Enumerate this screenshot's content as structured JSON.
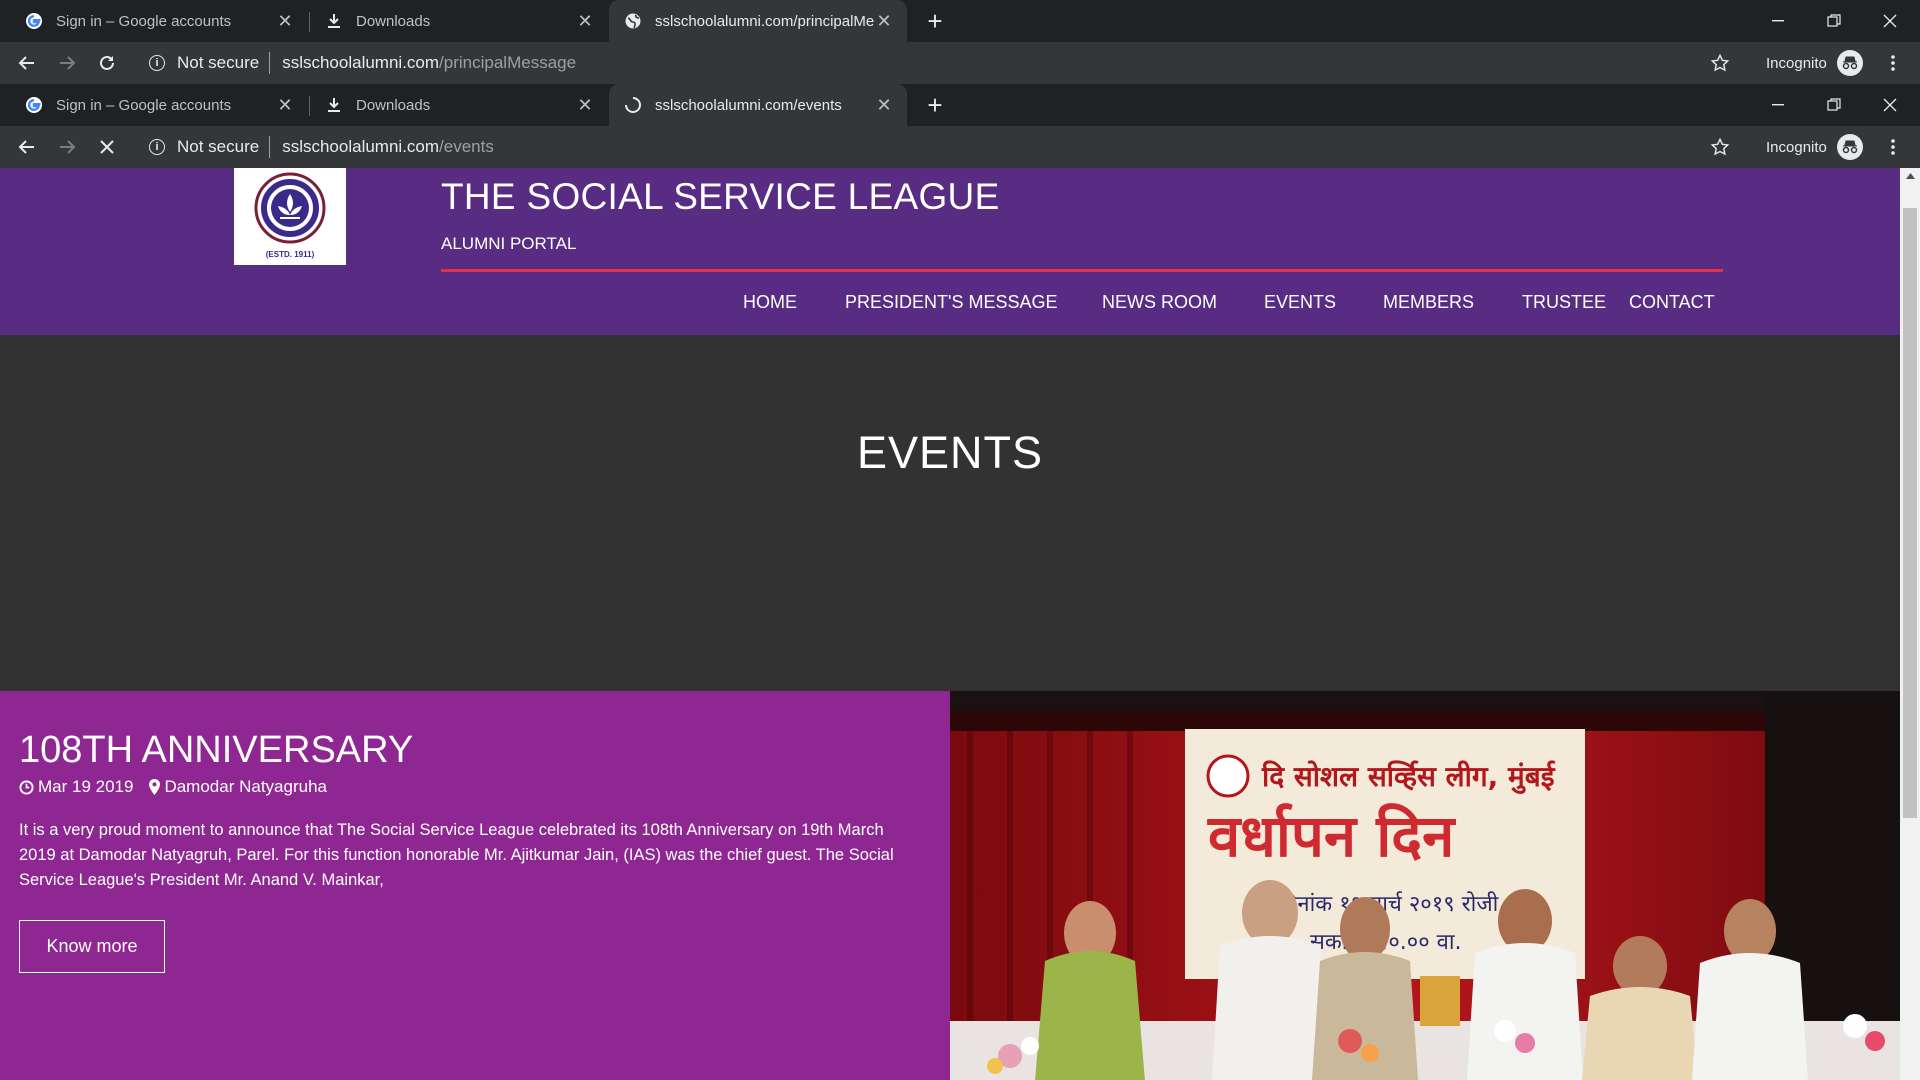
{
  "browser_back": {
    "tabs": [
      {
        "title": "Sign in – Google accounts",
        "favicon": "google-g-icon"
      },
      {
        "title": "Downloads",
        "favicon": "download-icon"
      },
      {
        "title": "sslschoolalumni.com/principalMe",
        "favicon": "globe-icon"
      }
    ],
    "security_label": "Not secure",
    "url_host": "sslschoolalumni.com",
    "url_path": "/principalMessage",
    "incognito_label": "Incognito"
  },
  "browser": {
    "tabs": [
      {
        "title": "Sign in – Google accounts",
        "favicon": "google-g-icon"
      },
      {
        "title": "Downloads",
        "favicon": "download-icon"
      },
      {
        "title": "sslschoolalumni.com/events",
        "favicon": "loading-spinner-icon"
      }
    ],
    "security_label": "Not secure",
    "url_host": "sslschoolalumni.com",
    "url_path": "/events",
    "incognito_label": "Incognito"
  },
  "site": {
    "logo_text": "(ESTD. 1911)",
    "title": "THE SOCIAL SERVICE LEAGUE",
    "subtitle": "ALUMNI PORTAL",
    "nav": [
      "HOME",
      "PRESIDENT'S MESSAGE",
      "NEWS ROOM",
      "EVENTS",
      "MEMBERS",
      "TRUSTEE",
      "CONTACT"
    ]
  },
  "page": {
    "heading": "EVENTS"
  },
  "event": {
    "title": "108TH ANNIVERSARY",
    "date": "Mar 19 2019",
    "location": "Damodar Natyagruha",
    "description": "It is a very proud moment to announce that The Social Service League celebrated its 108th Anniversary on 19th March 2019 at Damodar Natyagruh, Parel. For this function honorable Mr. Ajitkumar Jain, (IAS) was the chief guest. The Social Service League's President Mr. Anand V. Mainkar,",
    "button_label": "Know more",
    "photo_banner_line1": "दि सोशल सर्व्हिस लीग, मुंबई",
    "photo_banner_line2": "वर्धापन दिन",
    "photo_banner_line3": "दिनांक १९ मार्च २०१९ रोजी",
    "photo_banner_line4": "सकाळी १०.०० वा."
  },
  "colors": {
    "chrome_dark": "#202124",
    "chrome_toolbar": "#35363a",
    "header_purple": "#582c83",
    "accent_red": "#e0334a",
    "hero_dark": "#323233",
    "event_magenta": "#8f2793"
  }
}
